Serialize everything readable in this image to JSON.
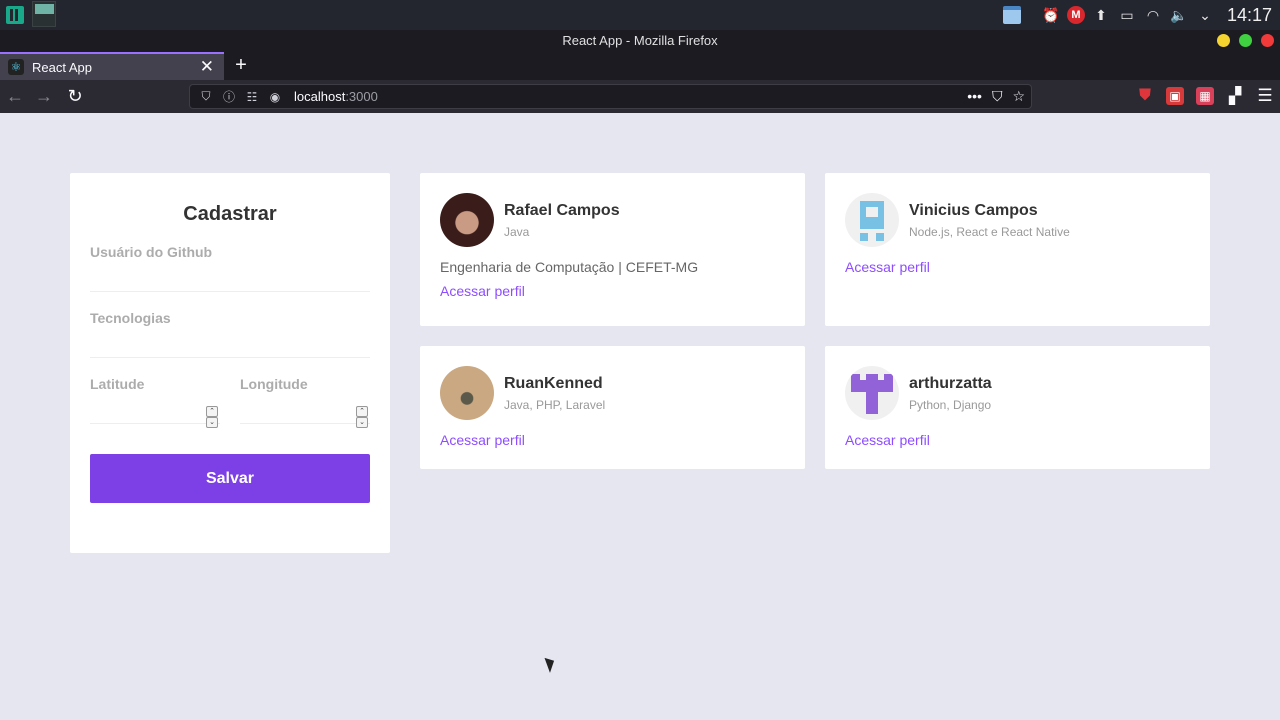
{
  "os_panel": {
    "clock": "14:17"
  },
  "window": {
    "title": "React App - Mozilla Firefox"
  },
  "tabs": [
    {
      "label": "React App"
    }
  ],
  "navbar": {
    "url_host": "localhost",
    "url_port": ":3000"
  },
  "form": {
    "title": "Cadastrar",
    "github_label": "Usuário do Github",
    "techs_label": "Tecnologias",
    "latitude_label": "Latitude",
    "longitude_label": "Longitude",
    "save_label": "Salvar"
  },
  "devs": [
    {
      "name": "Rafael Campos",
      "techs": "Java",
      "bio": "Engenharia de Computação | CEFET-MG",
      "link": "Acessar perfil"
    },
    {
      "name": "Vinicius Campos",
      "techs": "Node.js, React e React Native",
      "bio": "",
      "link": "Acessar perfil"
    },
    {
      "name": "RuanKenned",
      "techs": "Java, PHP, Laravel",
      "bio": "",
      "link": "Acessar perfil"
    },
    {
      "name": "arthurzatta",
      "techs": "Python, Django",
      "bio": "",
      "link": "Acessar perfil"
    }
  ],
  "colors": {
    "accent": "#7d40e7",
    "link": "#8e4dff",
    "background": "#e5e6f0"
  },
  "icons": {
    "back": "arrow-left-icon",
    "forward": "arrow-right-icon",
    "reload": "reload-icon",
    "close_tab": "close-icon",
    "new_tab": "plus-icon"
  }
}
